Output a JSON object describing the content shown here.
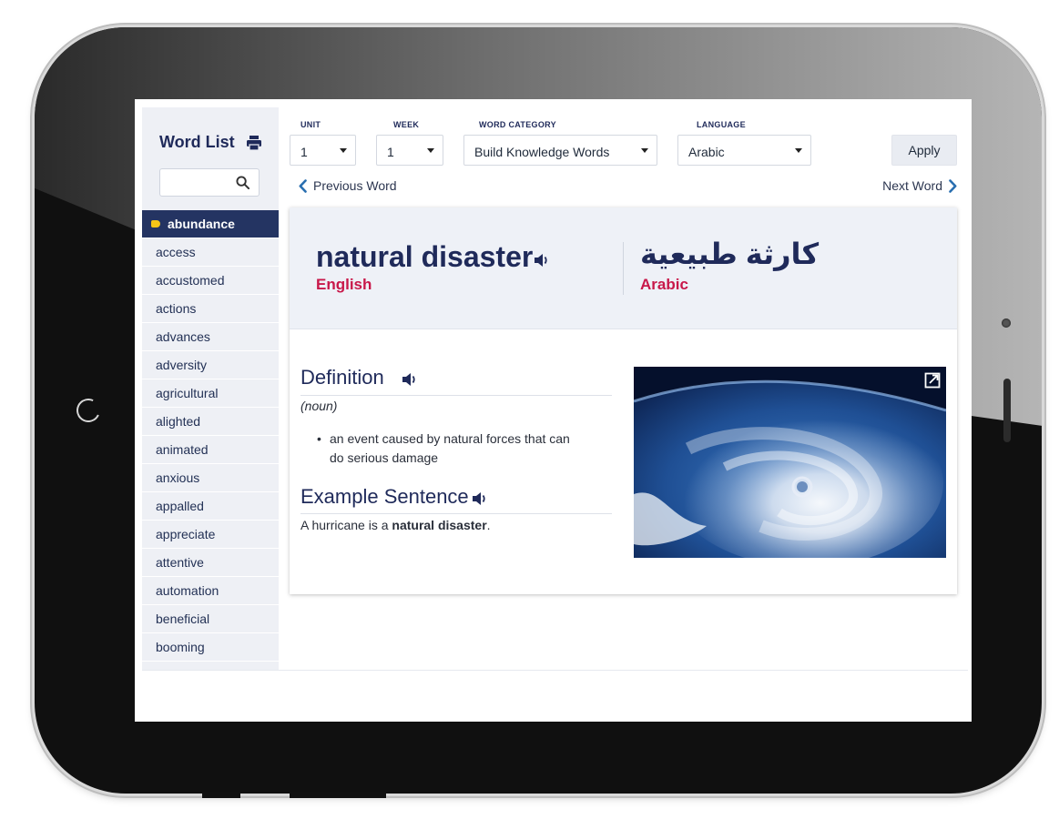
{
  "sidebar": {
    "title": "Word List",
    "search": {
      "placeholder": "",
      "value": ""
    },
    "words": [
      "abundance",
      "access",
      "accustomed",
      "actions",
      "advances",
      "adversity",
      "agricultural",
      "alighted",
      "animated",
      "anxious",
      "appalled",
      "appreciate",
      "attentive",
      "automation",
      "beneficial",
      "booming"
    ],
    "active_index": 0
  },
  "filters": {
    "unit": {
      "label": "UNIT",
      "value": "1"
    },
    "week": {
      "label": "WEEK",
      "value": "1"
    },
    "category": {
      "label": "WORD CATEGORY",
      "value": "Build Knowledge Words"
    },
    "language": {
      "label": "LANGUAGE",
      "value": "Arabic"
    },
    "apply_label": "Apply"
  },
  "nav": {
    "previous": "Previous Word",
    "next": "Next Word"
  },
  "entry": {
    "term": "natural disaster",
    "term_language": "English",
    "translation": "كارثة طبيعية",
    "translation_language": "Arabic",
    "definition_title": "Definition",
    "part_of_speech": "(noun)",
    "definition": "an event caused by natural forces that can do serious damage",
    "example_title": "Example Sentence",
    "example_prefix": "A hurricane is a ",
    "example_bold": "natural disaster",
    "example_suffix": "."
  },
  "colors": {
    "navy": "#1f2a5a",
    "active_bg": "#243462",
    "accent_red": "#c8184a",
    "tag_yellow": "#f5c518",
    "sidebar_bg": "#eef0f5"
  },
  "icons": [
    "print-icon",
    "search-icon",
    "chevron-left-icon",
    "chevron-right-icon",
    "speaker-icon",
    "expand-icon",
    "caret-down-icon"
  ]
}
